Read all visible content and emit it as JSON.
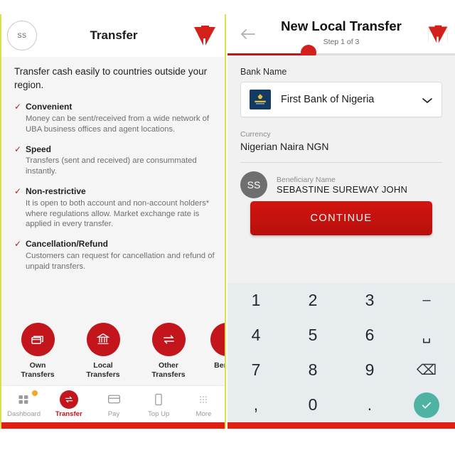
{
  "colors": {
    "brand_red": "#c3161c",
    "bar_red": "#e01f12",
    "divider_green": "#d7e24a",
    "teal_confirm": "#4fb3a4",
    "badge_orange": "#f5a623",
    "bank_navy": "#123a63"
  },
  "left": {
    "avatar_initials": "SS",
    "title": "Transfer",
    "logo_name": "uba-logo",
    "lead": "Transfer cash easily to countries outside your region.",
    "features": [
      {
        "title": "Convenient",
        "desc": "Money can be sent/received from a wide network of UBA business offices and agent locations."
      },
      {
        "title": "Speed",
        "desc": "Transfers (sent and received) are consummated instantly."
      },
      {
        "title": "Non-restrictive",
        "desc": "It is open to both account and non-account holders* where regulations allow. Market exchange rate is applied in every transfer."
      },
      {
        "title": "Cancellation/Refund",
        "desc": "Customers can request for cancellation and refund of unpaid transfers."
      }
    ],
    "quick_actions": [
      {
        "label": "Own Transfers",
        "icon": "cards-icon"
      },
      {
        "label": "Local Transfers",
        "icon": "bank-icon"
      },
      {
        "label": "Other Transfers",
        "icon": "exchange-arrows-icon"
      },
      {
        "label": "Bene",
        "icon": "beneficiary-icon"
      }
    ],
    "nav": [
      {
        "label": "Dashboard",
        "icon": "grid-icon",
        "active": false,
        "badge": true
      },
      {
        "label": "Transfer",
        "icon": "transfer-icon",
        "active": true,
        "badge": false
      },
      {
        "label": "Pay",
        "icon": "card-icon",
        "active": false,
        "badge": false
      },
      {
        "label": "Top Up",
        "icon": "phone-icon",
        "active": false,
        "badge": false
      },
      {
        "label": "More",
        "icon": "dots-grid-icon",
        "active": false,
        "badge": false
      }
    ]
  },
  "right": {
    "back_icon": "back-arrow-icon",
    "title": "New Local Transfer",
    "step": "Step 1 of 3",
    "logo_name": "uba-logo",
    "bank_name_label": "Bank Name",
    "bank_selected": "First Bank of Nigeria",
    "bank_logo_name": "first-bank-logo",
    "currency_label": "Currency",
    "currency_value": "Nigerian Naira NGN",
    "beneficiary_label": "Beneficiary Name",
    "beneficiary_name": "SEBASTINE SUREWAY JOHN",
    "beneficiary_initials": "SS",
    "continue_label": "CONTINUE",
    "keypad": [
      {
        "label": "1",
        "type": "digit"
      },
      {
        "label": "2",
        "type": "digit"
      },
      {
        "label": "3",
        "type": "digit"
      },
      {
        "label": "–",
        "type": "dash"
      },
      {
        "label": "4",
        "type": "digit"
      },
      {
        "label": "5",
        "type": "digit"
      },
      {
        "label": "6",
        "type": "digit"
      },
      {
        "label": "␣",
        "type": "space"
      },
      {
        "label": "7",
        "type": "digit"
      },
      {
        "label": "8",
        "type": "digit"
      },
      {
        "label": "9",
        "type": "digit"
      },
      {
        "label": "⌫",
        "type": "backspace"
      },
      {
        "label": ",",
        "type": "comma"
      },
      {
        "label": "0",
        "type": "digit"
      },
      {
        "label": ".",
        "type": "period"
      },
      {
        "label": "✓",
        "type": "confirm"
      }
    ]
  }
}
